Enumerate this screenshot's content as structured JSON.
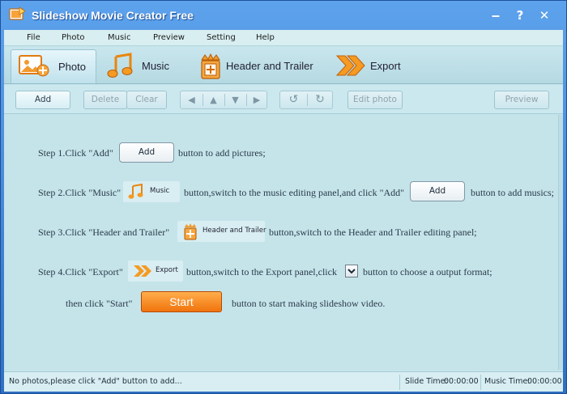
{
  "window": {
    "title": "Slideshow Movie Creator Free",
    "controls": {
      "minimize": "‒",
      "help": "?",
      "close": "✕"
    }
  },
  "menu": [
    {
      "label": "File"
    },
    {
      "label": "Photo"
    },
    {
      "label": "Music"
    },
    {
      "label": "Preview"
    },
    {
      "label": "Setting"
    },
    {
      "label": "Help"
    }
  ],
  "tabs": [
    {
      "label": "Photo",
      "icon": "photo-add-icon",
      "active": true
    },
    {
      "label": "Music",
      "icon": "music-notes-icon",
      "active": false
    },
    {
      "label": "Header and Trailer",
      "icon": "header-trailer-icon",
      "active": false
    },
    {
      "label": "Export",
      "icon": "export-arrows-icon",
      "active": false
    }
  ],
  "toolbar": {
    "add": "Add",
    "delete": "Delete",
    "clear": "Clear",
    "nav_icons": [
      "arrow-left-icon",
      "arrow-up-icon",
      "arrow-down-icon",
      "arrow-right-icon"
    ],
    "rotate_icons": [
      "rotate-left-icon",
      "rotate-right-icon"
    ],
    "edit_photo": "Edit photo",
    "preview": "Preview"
  },
  "steps": {
    "step1": {
      "prefix": "Step 1.Click \"Add\"",
      "button": "Add",
      "suffix": "button to add pictures;"
    },
    "step2": {
      "prefix": "Step 2.Click \"Music\"",
      "chip": "Music",
      "middle": "button,switch to the music editing panel,and click \"Add\"",
      "button": "Add",
      "suffix": "button to add musics;"
    },
    "step3": {
      "prefix": "Step 3.Click \"Header and Trailer\"",
      "chip": "Header and Trailer",
      "suffix": "button,switch to the Header and Trailer editing panel;"
    },
    "step4": {
      "prefix": "Step 4.Click \"Export\"",
      "chip": "Export",
      "middle": "button,switch to the Export panel,click",
      "suffix": "button to choose a output format;"
    },
    "step5": {
      "prefix": "then click \"Start\"",
      "button": "Start",
      "suffix": "button to start making slideshow video."
    }
  },
  "status": {
    "message": "No photos,please click \"Add\" button to add...",
    "slide_time_label": "Slide Time:",
    "slide_time": "00:00:00",
    "music_time_label": "Music Time:",
    "music_time": "00:00:00"
  },
  "colors": {
    "title_bar": "#3f86d9",
    "panel_background": "#c5e4ea",
    "start_button": "#f5820f",
    "icon_orange": "#f08a1c"
  }
}
